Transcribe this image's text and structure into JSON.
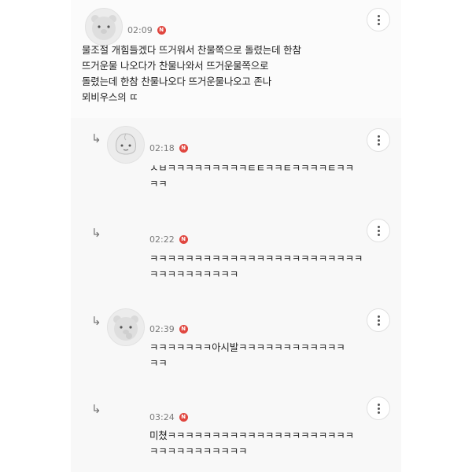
{
  "comments": [
    {
      "time": "02:09",
      "badge": "N",
      "text": "물조절 개힘들겠다 뜨거워서 찬물쪽으로 돌렸는데 한참\n뜨거운물 나오다가 찬물나와서 뜨거운물쪽으로\n돌렸는데 한참 찬물나오다 뜨거운물나오고 존나\n뫼비우스의 ㄸ",
      "avatar_icon": "bear-face-icon",
      "reply": false
    },
    {
      "time": "02:18",
      "badge": "N",
      "text": "ㅅㅂㅋㅋㅋㅋㅋㅋㅋㅋㅋㅌㅌㅋㅋㅌㅋㅋㅋㅋㅌㅋㅋ\nㅋㅋ",
      "avatar_icon": "peach-face-icon",
      "reply": true
    },
    {
      "time": "02:22",
      "badge": "N",
      "text": "ㅋㅋㅋㅋㅋㅋㅋㅋㅋㅋㅋㅋㅋㅋㅋㅋㅋㅋㅋㅋㅋㅋㅋㅋ\nㅋㅋㅋㅋㅋㅋㅋㅋㅋㅋ",
      "avatar_icon": "",
      "reply": true
    },
    {
      "time": "02:39",
      "badge": "N",
      "text": "ㅋㅋㅋㅋㅋㅋㅋ아시발ㅋㅋㅋㅋㅋㅋㅋㅋㅋㅋㅋㅋ\nㅋㅋ",
      "avatar_icon": "bear-face-icon",
      "reply": true
    },
    {
      "time": "03:24",
      "badge": "N",
      "text": "미쳤ㅋㅋㅋㅋㅋㅋㅋㅋㅋㅋㅋㅋㅋㅋㅋㅋㅋㅋㅋㅋㅋ\nㅋㅋㅋㅋㅋㅋㅋㅋㅋㅋㅋ",
      "avatar_icon": "",
      "reply": true
    }
  ],
  "colors": {
    "badge": "#e0463f",
    "timestamp": "#7a7a7a"
  }
}
